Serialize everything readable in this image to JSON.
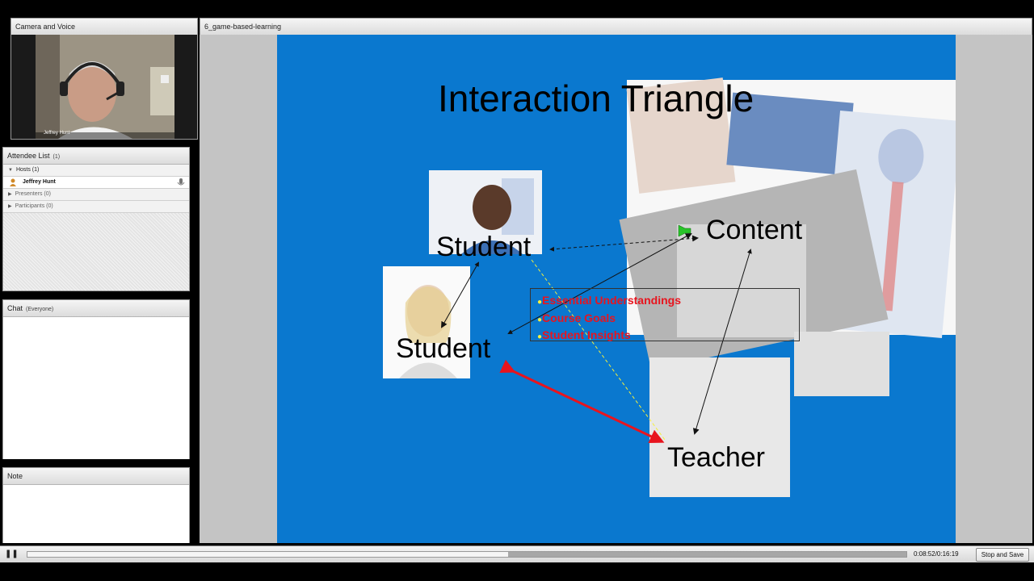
{
  "camera_pod": {
    "title": "Camera and Voice",
    "presenter_name": "Jeffrey Hunt"
  },
  "slide_pod": {
    "title": "6_game-based-learning"
  },
  "attendee_pod": {
    "title": "Attendee List",
    "count": "(1)",
    "hosts_label": "Hosts (1)",
    "host_name": "Jeffrey Hunt",
    "presenters_label": "Presenters (0)",
    "participants_label": "Participants (0)"
  },
  "chat_pod": {
    "title": "Chat",
    "scope": "(Everyone)"
  },
  "note_pod": {
    "title": "Note"
  },
  "slide": {
    "title": "Interaction Triangle",
    "student_top": "Student",
    "student_left": "Student",
    "content": "Content",
    "teacher": "Teacher",
    "bullets": [
      "Essential Understandings",
      "Course Goals",
      "Student Insights"
    ],
    "bullet_color": "#e8141e"
  },
  "playback": {
    "pause_icon": "pause-icon",
    "progress": 0.547,
    "time": "0:08:52/0:16:19",
    "stop_label": "Stop and Save"
  },
  "colors": {
    "slide_bg": "#0a78cf",
    "red_arrow": "#e8141e",
    "yellow_dash": "#f5f03c"
  }
}
